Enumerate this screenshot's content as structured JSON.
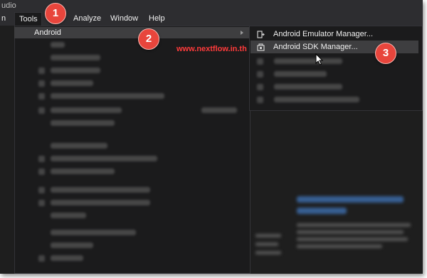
{
  "window": {
    "title_fragment": "udio"
  },
  "menubar": {
    "items": [
      {
        "label": "n"
      },
      {
        "label": "Tools"
      },
      {
        "label": "Analyze"
      },
      {
        "label": "Window"
      },
      {
        "label": "Help"
      }
    ]
  },
  "tools_menu": {
    "android_label": "Android"
  },
  "android_submenu": {
    "items": [
      {
        "label": "Android Emulator Manager...",
        "icon": "emulator-icon"
      },
      {
        "label": "Android SDK Manager...",
        "icon": "sdk-icon",
        "highlighted": true
      }
    ]
  },
  "watermark": "www.nextflow.in.th",
  "steps": [
    "1",
    "2",
    "3"
  ],
  "colors": {
    "menu_bg": "#1b1b1c",
    "highlight": "#3e3e40",
    "badge": "#e8453c",
    "watermark": "#ff3b3b"
  }
}
